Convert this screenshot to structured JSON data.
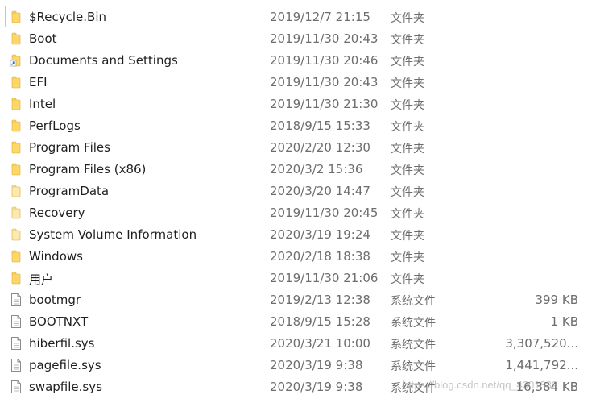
{
  "files": [
    {
      "name": "$Recycle.Bin",
      "date": "2019/12/7 21:15",
      "type": "文件夹",
      "size": "",
      "icon": "folder-icon",
      "selected": true
    },
    {
      "name": "Boot",
      "date": "2019/11/30 20:43",
      "type": "文件夹",
      "size": "",
      "icon": "folder-icon"
    },
    {
      "name": "Documents and Settings",
      "date": "2019/11/30 20:46",
      "type": "文件夹",
      "size": "",
      "icon": "folder-shortcut-icon"
    },
    {
      "name": "EFI",
      "date": "2019/11/30 20:43",
      "type": "文件夹",
      "size": "",
      "icon": "folder-icon"
    },
    {
      "name": "Intel",
      "date": "2019/11/30 21:30",
      "type": "文件夹",
      "size": "",
      "icon": "folder-icon"
    },
    {
      "name": "PerfLogs",
      "date": "2018/9/15 15:33",
      "type": "文件夹",
      "size": "",
      "icon": "folder-icon"
    },
    {
      "name": "Program Files",
      "date": "2020/2/20 12:30",
      "type": "文件夹",
      "size": "",
      "icon": "folder-icon"
    },
    {
      "name": "Program Files (x86)",
      "date": "2020/3/2 15:36",
      "type": "文件夹",
      "size": "",
      "icon": "folder-icon"
    },
    {
      "name": "ProgramData",
      "date": "2020/3/20 14:47",
      "type": "文件夹",
      "size": "",
      "icon": "folder-hidden-icon"
    },
    {
      "name": "Recovery",
      "date": "2019/11/30 20:45",
      "type": "文件夹",
      "size": "",
      "icon": "folder-hidden-icon"
    },
    {
      "name": "System Volume Information",
      "date": "2020/3/19 19:24",
      "type": "文件夹",
      "size": "",
      "icon": "folder-hidden-icon"
    },
    {
      "name": "Windows",
      "date": "2020/2/18 18:38",
      "type": "文件夹",
      "size": "",
      "icon": "folder-icon"
    },
    {
      "name": "用户",
      "date": "2019/11/30 21:06",
      "type": "文件夹",
      "size": "",
      "icon": "folder-icon"
    },
    {
      "name": "bootmgr",
      "date": "2019/2/13 12:38",
      "type": "系统文件",
      "size": "399 KB",
      "icon": "file-icon"
    },
    {
      "name": "BOOTNXT",
      "date": "2018/9/15 15:28",
      "type": "系统文件",
      "size": "1 KB",
      "icon": "file-icon"
    },
    {
      "name": "hiberfil.sys",
      "date": "2020/3/21 10:00",
      "type": "系统文件",
      "size": "3,307,520...",
      "icon": "file-icon"
    },
    {
      "name": "pagefile.sys",
      "date": "2020/3/19 9:38",
      "type": "系统文件",
      "size": "1,441,792...",
      "icon": "file-icon"
    },
    {
      "name": "swapfile.sys",
      "date": "2020/3/19 9:38",
      "type": "系统文件",
      "size": "16,384 KB",
      "icon": "file-icon"
    }
  ],
  "watermark": "https://blog.csdn.net/qq_4301332",
  "colors": {
    "folder": "#ffd766",
    "folder_hidden": "#fde9ad",
    "selection_border": "#99d1ff",
    "shortcut_arrow": "#1a5fb4"
  }
}
